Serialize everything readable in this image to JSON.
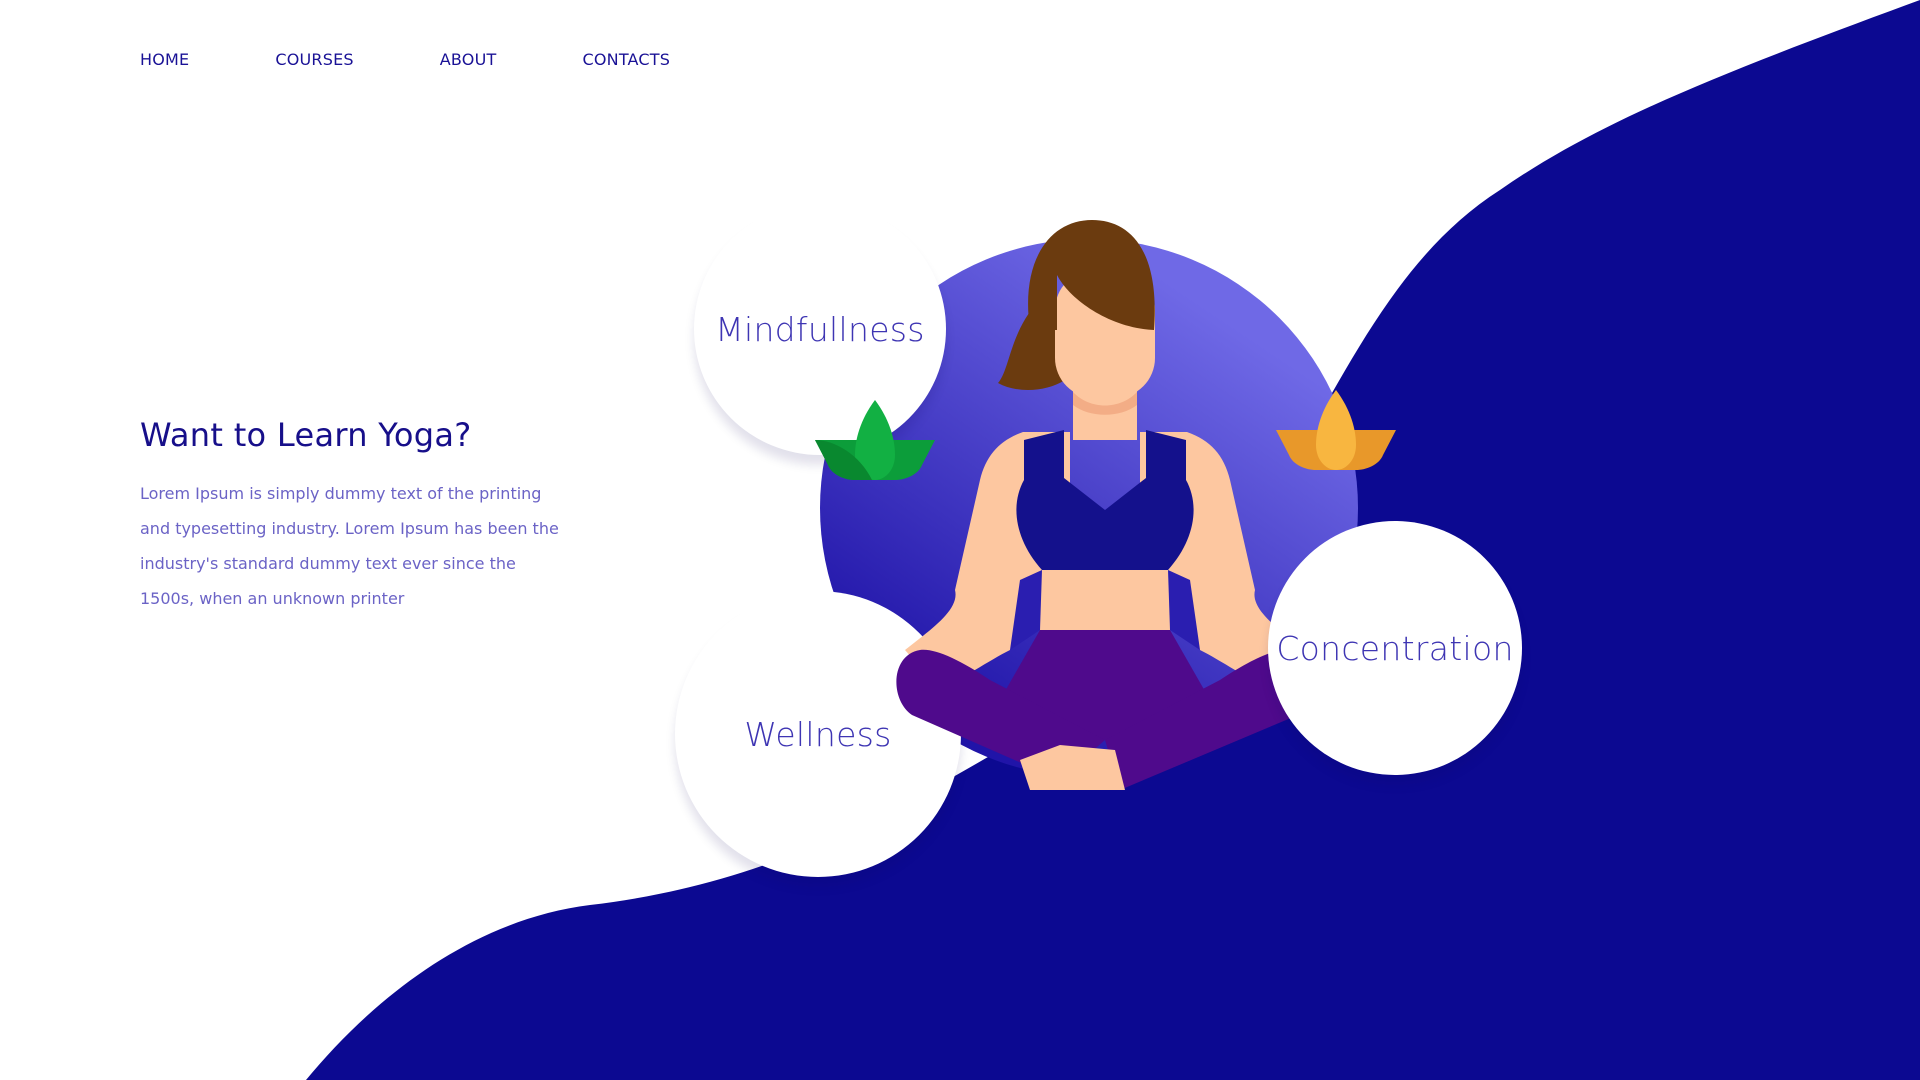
{
  "nav": {
    "items": [
      {
        "label": "HOME"
      },
      {
        "label": "COURSES"
      },
      {
        "label": "ABOUT"
      },
      {
        "label": "CONTACTS"
      }
    ]
  },
  "hero": {
    "title": "Want to Learn Yoga?",
    "body": "Lorem Ipsum is simply dummy text of the printing and typesetting industry. Lorem Ipsum has been the industry's standard dummy text ever since the 1500s, when an unknown printer"
  },
  "bubbles": {
    "mindfulness": "Mindfullness",
    "wellness": "Wellness",
    "concentration": "Concentration"
  },
  "colors": {
    "accent": "#0c0991",
    "nav_text": "#1a1296",
    "body_text": "#6b63c6",
    "circle_top": "#6f69e6",
    "circle_bottom": "#2014a8",
    "lotus_green": "#0c9d3a",
    "lotus_orange": "#f0a030",
    "skin": "#fdc7a0",
    "hair": "#6b3b0f",
    "top": "#14118c",
    "pants": "#4f0a8c"
  },
  "icons": [
    "lotus-icon-green",
    "lotus-icon-orange",
    "yoga-woman-illustration"
  ]
}
